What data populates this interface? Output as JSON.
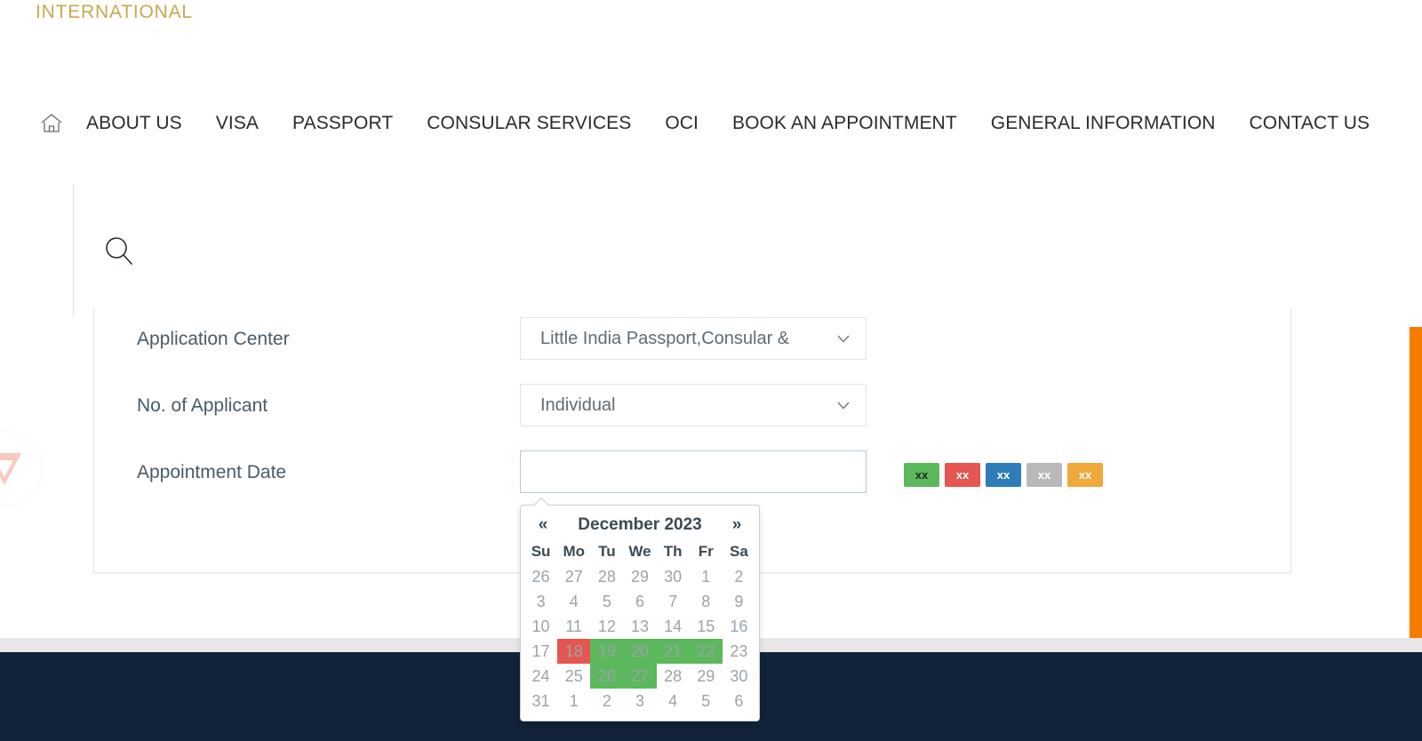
{
  "brand": {
    "logo_text": "INTERNATIONAL",
    "logo_color": "#c6a94f"
  },
  "nav": {
    "home_icon": "home-icon",
    "items": [
      {
        "label": "ABOUT US"
      },
      {
        "label": "VISA"
      },
      {
        "label": "PASSPORT"
      },
      {
        "label": "CONSULAR SERVICES"
      },
      {
        "label": "OCI"
      },
      {
        "label": "BOOK AN APPOINTMENT"
      },
      {
        "label": "GENERAL INFORMATION"
      },
      {
        "label": "CONTACT US"
      }
    ]
  },
  "search": {
    "icon": "search-icon"
  },
  "form": {
    "rows": [
      {
        "label": "Application Center",
        "control": "select",
        "value": "Little India Passport,Consular &"
      },
      {
        "label": "No. of Applicant",
        "control": "select",
        "value": "Individual"
      },
      {
        "label": "Appointment Date",
        "control": "date",
        "value": "",
        "placeholder": ""
      }
    ]
  },
  "legend": {
    "swatches": [
      {
        "label": "xx",
        "color": "#5cb85c",
        "text_color": "#1d2b1d"
      },
      {
        "label": "xx",
        "color": "#e4564f",
        "text_color": "#ffffff"
      },
      {
        "label": "xx",
        "color": "#2e7cb8",
        "text_color": "#ffffff"
      },
      {
        "label": "xx",
        "color": "#b9b9b9",
        "text_color": "#ffffff"
      },
      {
        "label": "xx",
        "color": "#efa83c",
        "text_color": "#ffffff"
      }
    ]
  },
  "datepicker": {
    "prev_label": "«",
    "next_label": "»",
    "title": "December 2023",
    "weekdays": [
      "Su",
      "Mo",
      "Tu",
      "We",
      "Th",
      "Fr",
      "Sa"
    ],
    "weeks": [
      [
        {
          "day": "26",
          "state": "dis"
        },
        {
          "day": "27",
          "state": "dis"
        },
        {
          "day": "28",
          "state": "dis"
        },
        {
          "day": "29",
          "state": "dis"
        },
        {
          "day": "30",
          "state": "dis"
        },
        {
          "day": "1",
          "state": "dis"
        },
        {
          "day": "2",
          "state": "dis"
        }
      ],
      [
        {
          "day": "3",
          "state": "dis"
        },
        {
          "day": "4",
          "state": "dis"
        },
        {
          "day": "5",
          "state": "dis"
        },
        {
          "day": "6",
          "state": "dis"
        },
        {
          "day": "7",
          "state": "dis"
        },
        {
          "day": "8",
          "state": "dis"
        },
        {
          "day": "9",
          "state": "dis"
        }
      ],
      [
        {
          "day": "10",
          "state": "dis"
        },
        {
          "day": "11",
          "state": "dis"
        },
        {
          "day": "12",
          "state": "dis"
        },
        {
          "day": "13",
          "state": "dis"
        },
        {
          "day": "14",
          "state": "dis"
        },
        {
          "day": "15",
          "state": "dis"
        },
        {
          "day": "16",
          "state": "dis"
        }
      ],
      [
        {
          "day": "17",
          "state": "dis"
        },
        {
          "day": "18",
          "state": "full"
        },
        {
          "day": "19",
          "state": "avail"
        },
        {
          "day": "20",
          "state": "avail"
        },
        {
          "day": "21",
          "state": "avail"
        },
        {
          "day": "22",
          "state": "avail"
        },
        {
          "day": "23",
          "state": "dis"
        }
      ],
      [
        {
          "day": "24",
          "state": "dis"
        },
        {
          "day": "25",
          "state": "dis"
        },
        {
          "day": "26",
          "state": "avail"
        },
        {
          "day": "27",
          "state": "avail"
        },
        {
          "day": "28",
          "state": "dis"
        },
        {
          "day": "29",
          "state": "dis"
        },
        {
          "day": "30",
          "state": "dis"
        }
      ],
      [
        {
          "day": "31",
          "state": "dis"
        },
        {
          "day": "1",
          "state": "dis"
        },
        {
          "day": "2",
          "state": "dis"
        },
        {
          "day": "3",
          "state": "dis"
        },
        {
          "day": "4",
          "state": "dis"
        },
        {
          "day": "5",
          "state": "dis"
        },
        {
          "day": "6",
          "state": "dis"
        }
      ]
    ]
  },
  "footer": {
    "band_color": "#e7e7e7",
    "bar_color": "#122339"
  },
  "side_tab": {
    "color": "#f57c00"
  }
}
